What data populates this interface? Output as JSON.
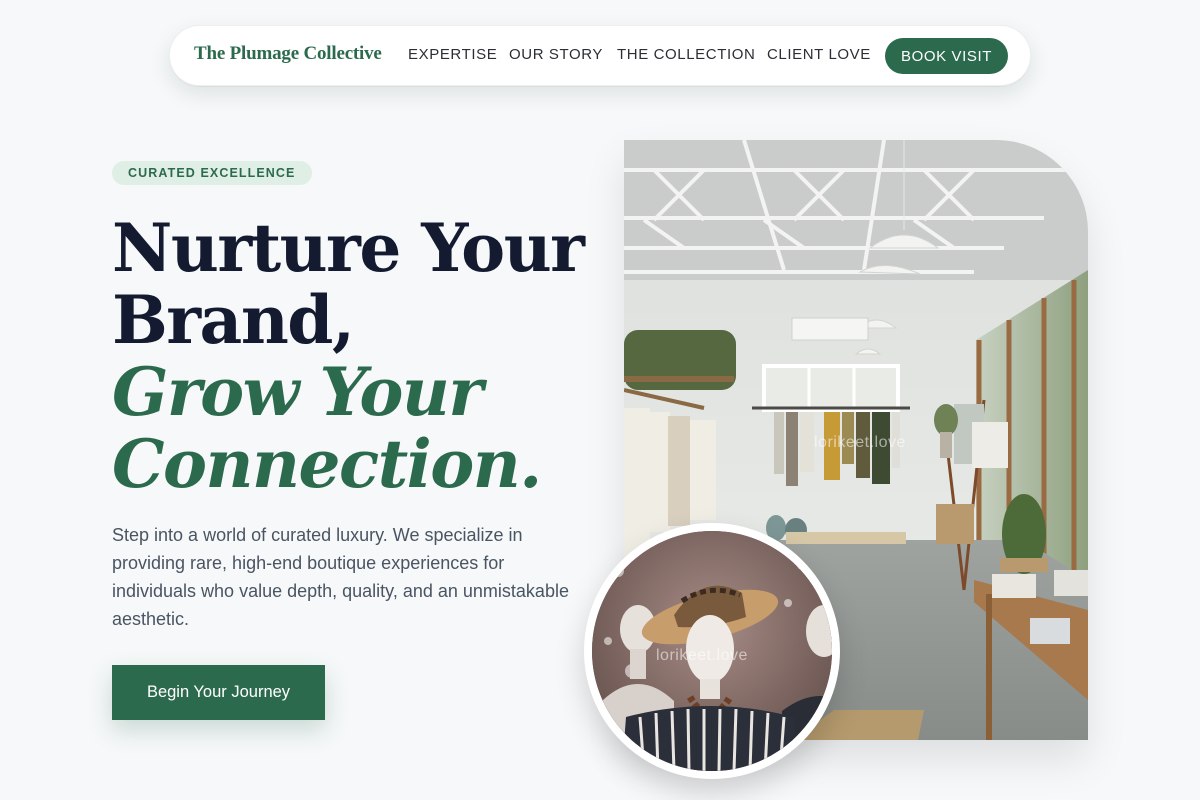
{
  "nav": {
    "brand": "The Plumage Collective",
    "links": [
      "EXPERTISE",
      "OUR STORY",
      "THE COLLECTION",
      "CLIENT LOVE"
    ],
    "cta": "BOOK VISIT"
  },
  "hero": {
    "badge": "CURATED EXCELLENCE",
    "headline_line1": "Nurture Your",
    "headline_line2": "Brand,",
    "headline_accent1": "Grow Your",
    "headline_accent2": "Connection.",
    "description": "Step into a world of curated luxury. We specialize in providing rare, high-end boutique experiences for individuals who value depth, quality, and an unmistakable aesthetic.",
    "cta": "Begin Your Journey"
  },
  "images": {
    "main_watermark": "lorikeet.love",
    "circle_watermark": "lorikeet.love"
  },
  "colors": {
    "brand_green": "#2c6a4e",
    "headline_navy": "#141b30",
    "badge_bg": "#e0efe6",
    "page_bg": "#f6f8f9"
  }
}
